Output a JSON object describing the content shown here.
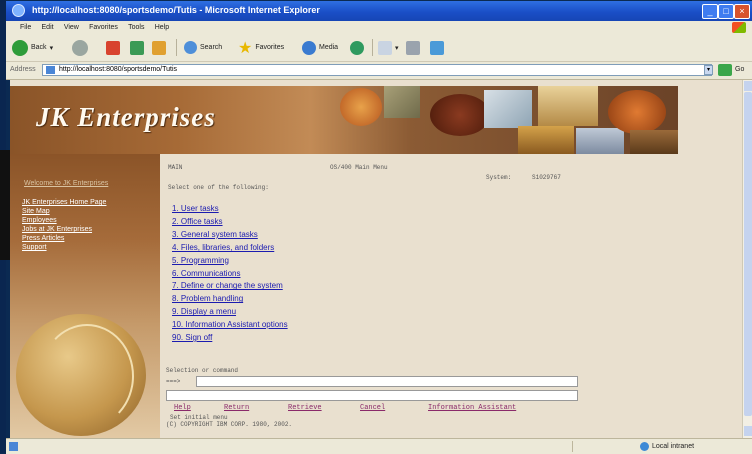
{
  "window": {
    "title": "http://localhost:8080/sportsdemo/Tutis - Microsoft Internet Explorer",
    "buttons": [
      "minimize",
      "maximize",
      "close"
    ]
  },
  "menubar": [
    "File",
    "Edit",
    "View",
    "Favorites",
    "Tools",
    "Help"
  ],
  "toolbar": {
    "back": "Back",
    "search": "Search",
    "favorites": "Favorites",
    "media": "Media"
  },
  "address": {
    "label": "Address",
    "url": "http://localhost:8080/sportsdemo/Tutis",
    "go": "Go"
  },
  "brand": {
    "logo": "JK Enterprises"
  },
  "sidebar": {
    "heading": "Welcome to JK Enterprises",
    "links": [
      "JK Enterprises Home Page",
      "Site Map",
      "Employees",
      "Jobs at JK Enterprises",
      "Press Articles",
      "Support"
    ]
  },
  "terminal": {
    "menu_label": "MAIN",
    "menu_title": "OS/400 Main Menu",
    "system_label": "System:",
    "system_name": "S1029767",
    "prompt": "Select one of the following:"
  },
  "menu_items": [
    "1. User tasks",
    "2. Office tasks",
    "3. General system tasks",
    "4. Files, libraries, and folders",
    "5. Programming",
    "6. Communications",
    "7. Define or change the system",
    "8. Problem handling",
    "9. Display a menu",
    "10. Information Assistant options",
    "90. Sign off"
  ],
  "command": {
    "selection_label": "Selection or command",
    "prompt": "===>",
    "value": ""
  },
  "function_keys": [
    "Help",
    "Return",
    "Retrieve",
    "Cancel",
    "Information Assistant"
  ],
  "function_keys_extra": "Set initial menu",
  "copyright": "(C) COPYRIGHT IBM CORP. 1980, 2002.",
  "statusbar": {
    "zone": "Local intranet"
  },
  "colors": {
    "titlebar": "#1a4fc7",
    "link": "#1b1bb0",
    "content_bg": "#e9e0cf",
    "sidebar": "#a56b3a"
  }
}
